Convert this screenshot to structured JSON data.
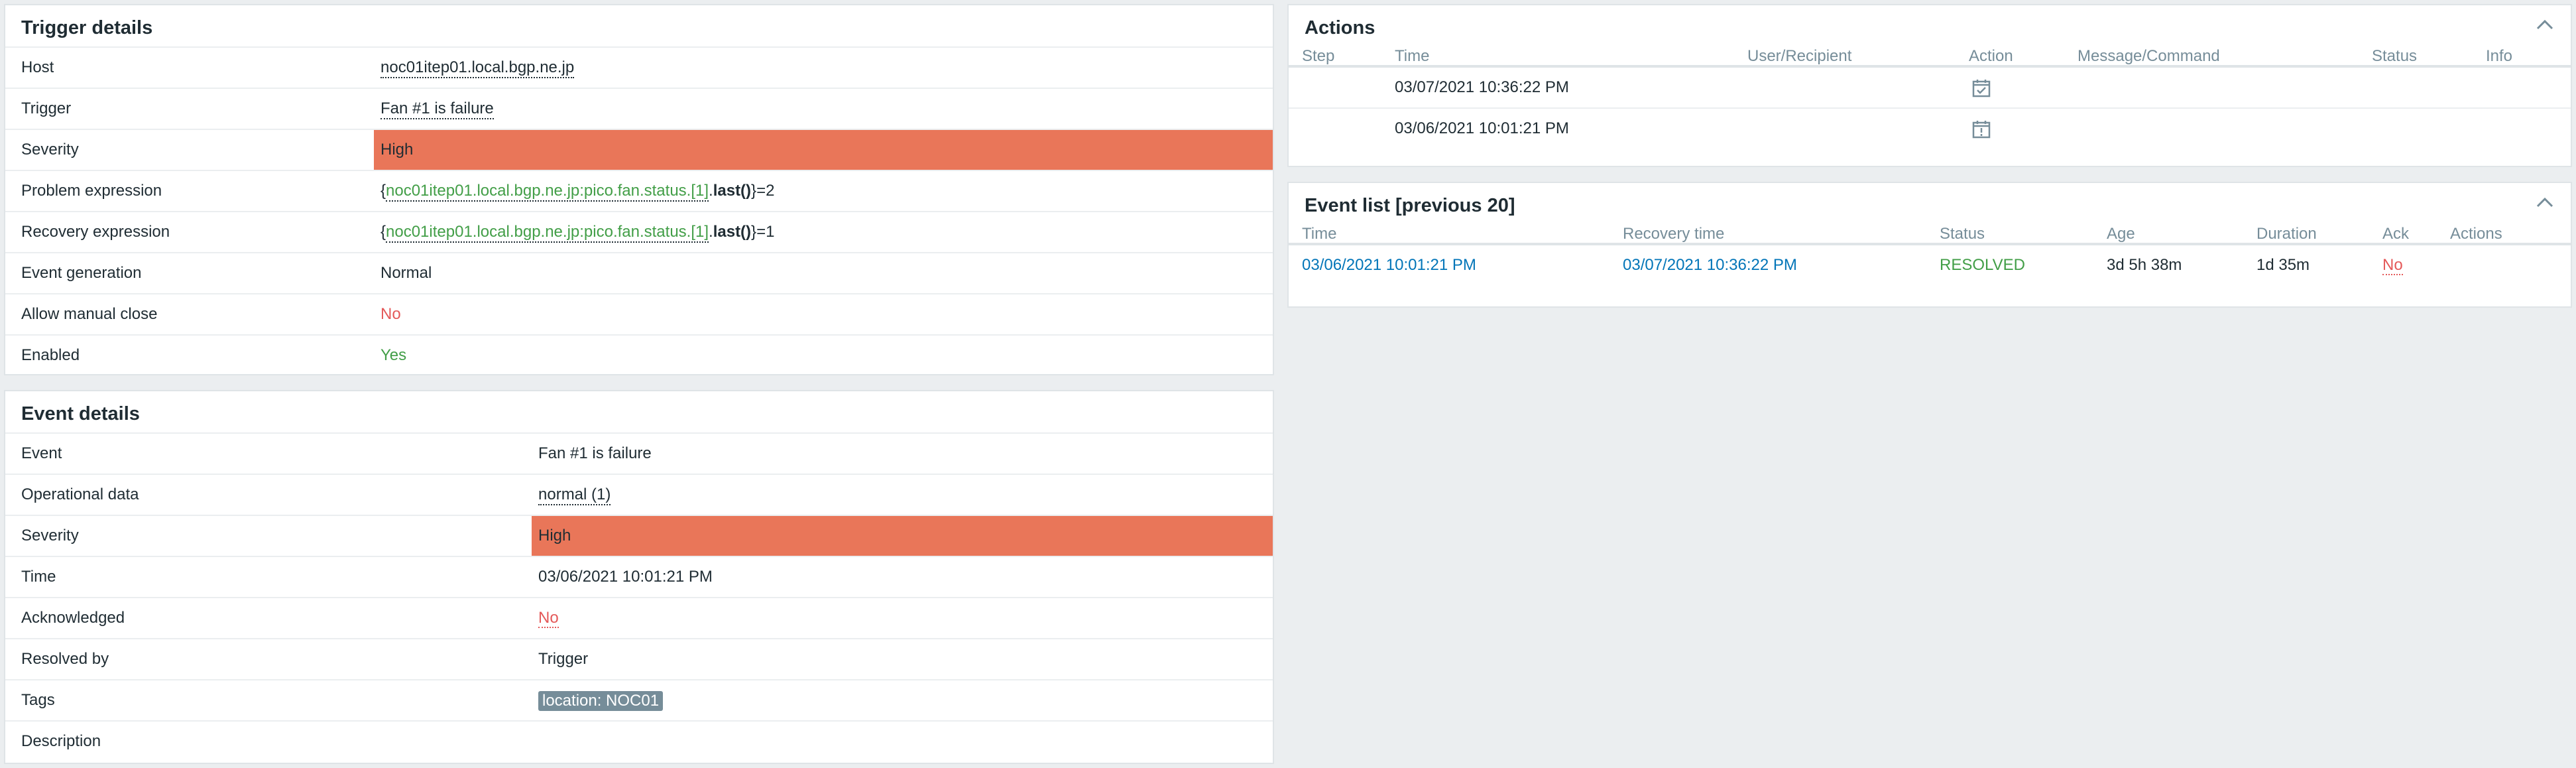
{
  "trigger_details": {
    "title": "Trigger details",
    "rows": {
      "host": {
        "label": "Host",
        "value": "noc01itep01.local.bgp.ne.jp"
      },
      "trigger": {
        "label": "Trigger",
        "value": "Fan #1 is failure"
      },
      "severity": {
        "label": "Severity",
        "value": "High"
      },
      "problem_expression": {
        "label": "Problem expression",
        "open": "{",
        "item": "noc01itep01.local.bgp.ne.jp:pico.fan.status.[1]",
        "dot": ".",
        "func": "last()",
        "close": "}=2"
      },
      "recovery_expression": {
        "label": "Recovery expression",
        "open": "{",
        "item": "noc01itep01.local.bgp.ne.jp:pico.fan.status.[1]",
        "dot": ".",
        "func": "last()",
        "close": "}=1"
      },
      "event_generation": {
        "label": "Event generation",
        "value": "Normal"
      },
      "allow_manual_close": {
        "label": "Allow manual close",
        "value": "No"
      },
      "enabled": {
        "label": "Enabled",
        "value": "Yes"
      }
    }
  },
  "event_details": {
    "title": "Event details",
    "rows": {
      "event": {
        "label": "Event",
        "value": "Fan #1 is failure"
      },
      "operational_data": {
        "label": "Operational data",
        "value": "normal (1)"
      },
      "severity": {
        "label": "Severity",
        "value": "High"
      },
      "time": {
        "label": "Time",
        "value": "03/06/2021 10:01:21 PM"
      },
      "acknowledged": {
        "label": "Acknowledged",
        "value": "No"
      },
      "resolved_by": {
        "label": "Resolved by",
        "value": "Trigger"
      },
      "tags": {
        "label": "Tags",
        "value": "location: NOC01"
      },
      "description": {
        "label": "Description",
        "value": ""
      }
    }
  },
  "actions": {
    "title": "Actions",
    "columns": {
      "step": "Step",
      "time": "Time",
      "user": "User/Recipient",
      "action": "Action",
      "message": "Message/Command",
      "status": "Status",
      "info": "Info"
    },
    "rows": [
      {
        "time": "03/07/2021 10:36:22 PM",
        "action_icon": "calendar-check-icon"
      },
      {
        "time": "03/06/2021 10:01:21 PM",
        "action_icon": "calendar-alert-icon"
      }
    ]
  },
  "event_list": {
    "title": "Event list [previous 20]",
    "columns": {
      "time": "Time",
      "recovery_time": "Recovery time",
      "status": "Status",
      "age": "Age",
      "duration": "Duration",
      "ack": "Ack",
      "actions": "Actions"
    },
    "rows": [
      {
        "time": "03/06/2021 10:01:21 PM",
        "recovery_time": "03/07/2021 10:36:22 PM",
        "status": "RESOLVED",
        "age": "3d 5h 38m",
        "duration": "1d 35m",
        "ack": "No"
      }
    ]
  },
  "colors": {
    "severity_high": "#e97659",
    "ok_green": "#429e47",
    "no_red": "#e45959",
    "link_blue": "#0275b8",
    "tag_bg": "#768d99"
  }
}
